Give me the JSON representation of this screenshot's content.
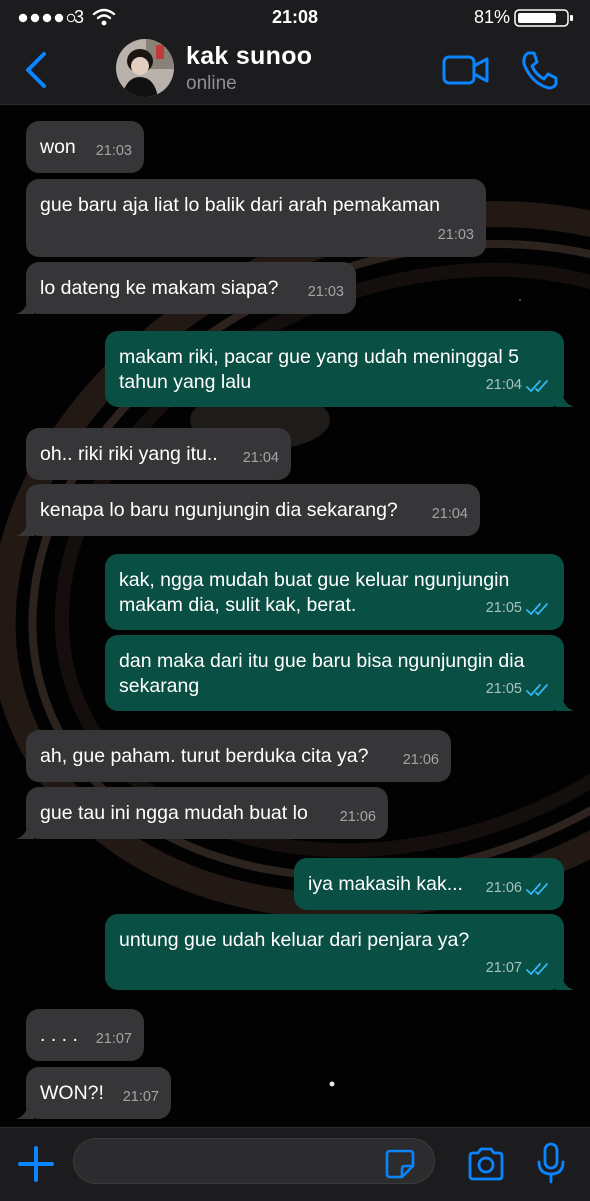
{
  "status_bar": {
    "carrier": "3",
    "time": "21:08",
    "battery": "81%"
  },
  "header": {
    "back_icon": "chevron-left-icon",
    "contact_name": "kak sunoo",
    "contact_status": "online",
    "video_icon": "video-camera-icon",
    "phone_icon": "phone-icon"
  },
  "messages": [
    {
      "dir": "in",
      "text": "won",
      "time": "21:03"
    },
    {
      "dir": "in",
      "text": "gue baru aja liat lo balik dari arah pemakaman",
      "time": "21:03"
    },
    {
      "dir": "in",
      "text": "lo dateng ke makam siapa?",
      "time": "21:03"
    },
    {
      "dir": "out",
      "text": "makam riki, pacar gue yang udah meninggal 5 tahun yang lalu",
      "time": "21:04",
      "read": true
    },
    {
      "dir": "in",
      "text": "oh.. riki riki yang itu..",
      "time": "21:04"
    },
    {
      "dir": "in",
      "text": "kenapa lo baru ngunjungin dia sekarang?",
      "time": "21:04"
    },
    {
      "dir": "out",
      "text": "kak, ngga mudah buat gue keluar ngunjungin makam dia, sulit kak, berat.",
      "time": "21:05",
      "read": true
    },
    {
      "dir": "out",
      "text": "dan maka dari itu gue baru bisa ngunjungin dia sekarang",
      "time": "21:05",
      "read": true
    },
    {
      "dir": "in",
      "text": "ah, gue paham. turut berduka cita ya?",
      "time": "21:06"
    },
    {
      "dir": "in",
      "text": "gue tau ini ngga mudah buat lo",
      "time": "21:06"
    },
    {
      "dir": "out",
      "text": "iya makasih kak...",
      "time": "21:06",
      "read": true
    },
    {
      "dir": "out",
      "text": "untung gue udah keluar dari penjara ya?",
      "time": "21:07",
      "read": true
    },
    {
      "dir": "in",
      "text": ". . . .",
      "time": "21:07"
    },
    {
      "dir": "in",
      "text": "WON?!",
      "time": "21:07"
    }
  ],
  "input_bar": {
    "attach_icon": "plus-icon",
    "placeholder": "",
    "sticker_icon": "sticker-icon",
    "camera_icon": "camera-icon",
    "mic_icon": "microphone-icon"
  },
  "colors": {
    "accent": "#0a84ff",
    "incoming_bubble": "#363638",
    "outgoing_bubble": "#0a4f43",
    "read_ticks": "#34b7f1"
  }
}
